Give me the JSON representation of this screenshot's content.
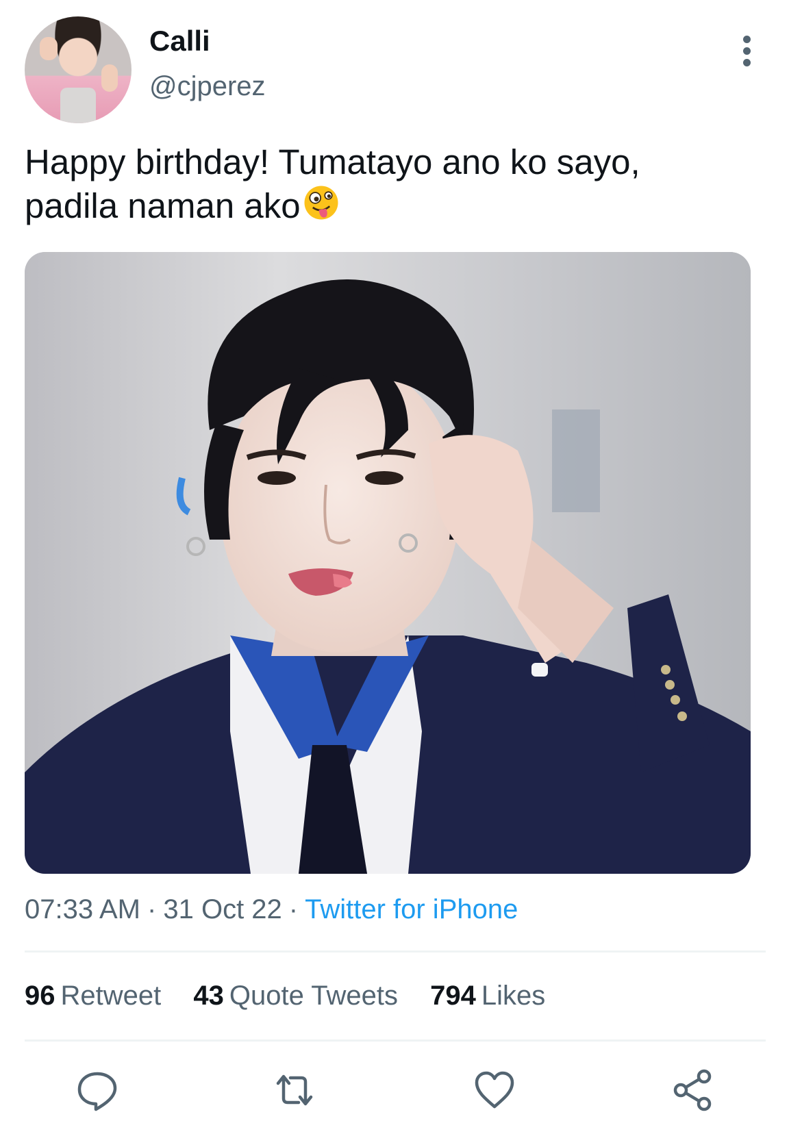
{
  "author": {
    "display_name": "Calli",
    "handle": "@cjperez"
  },
  "tweet": {
    "text": "Happy birthday! Tumatayo ano ko sayo, padila naman ako",
    "emoji": "zany-face-emoji"
  },
  "meta": {
    "time": "07:33 AM",
    "separator": "·",
    "date": "31 Oct 22",
    "source": "Twitter for iPhone"
  },
  "stats": {
    "retweets": {
      "count": "96",
      "label": "Retweet"
    },
    "quotes": {
      "count": "43",
      "label": "Quote Tweets"
    },
    "likes": {
      "count": "794",
      "label": "Likes"
    }
  },
  "icons": {
    "more": "more-vertical-icon",
    "reply": "reply-icon",
    "retweet": "retweet-icon",
    "like": "heart-icon",
    "share": "share-icon"
  },
  "colors": {
    "link": "#1d9bf0",
    "secondary_text": "#536471",
    "primary_text": "#0f1419",
    "divider": "#eff3f4"
  }
}
